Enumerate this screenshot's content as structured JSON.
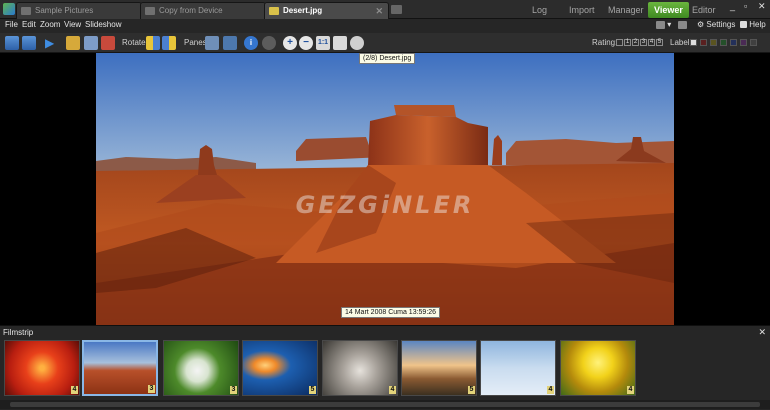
{
  "tabs": [
    {
      "label": "Sample Pictures",
      "active": false
    },
    {
      "label": "Copy from Device",
      "active": false
    },
    {
      "label": "Desert.jpg",
      "active": true
    }
  ],
  "modes": [
    "Log In",
    "Import",
    "Manager",
    "Viewer",
    "Editor"
  ],
  "active_mode": "Viewer",
  "window_controls": [
    "_",
    "▫",
    "✕"
  ],
  "menu": [
    "File",
    "Edit",
    "Zoom",
    "View",
    "Slideshow"
  ],
  "right_menu": {
    "settings_label": "Settings",
    "help_label": "Help"
  },
  "toolbar": {
    "rotate_label": "Rotate:",
    "panes_label": "Panes:",
    "rating_label": "Rating:",
    "rating_values": [
      "1",
      "2",
      "3",
      "4",
      "5"
    ],
    "label_label": "Label"
  },
  "tooltip_file": "(2/8) Desert.jpg",
  "tooltip_date": "14 Mart 2008 Cuma 13:59:26",
  "watermark": "GEZGiNLER",
  "filmstrip": {
    "title": "Filmstrip",
    "close": "✕",
    "thumbnails": [
      {
        "name": "Chrysanthemum",
        "rating": "4",
        "selected": false
      },
      {
        "name": "Desert",
        "rating": "3",
        "selected": true
      },
      {
        "name": "Hydrangeas",
        "rating": "3",
        "selected": false
      },
      {
        "name": "Jellyfish",
        "rating": "5",
        "selected": false
      },
      {
        "name": "Koala",
        "rating": "4",
        "selected": false
      },
      {
        "name": "Lighthouse",
        "rating": "5",
        "selected": false
      },
      {
        "name": "Penguins",
        "rating": "4",
        "selected": false
      },
      {
        "name": "Tulips",
        "rating": "4",
        "selected": false
      }
    ]
  },
  "colors": {
    "accent_mode": "#4f9e2c",
    "selection": "#8ab7e6",
    "rating_badge": "#e2d37a"
  }
}
